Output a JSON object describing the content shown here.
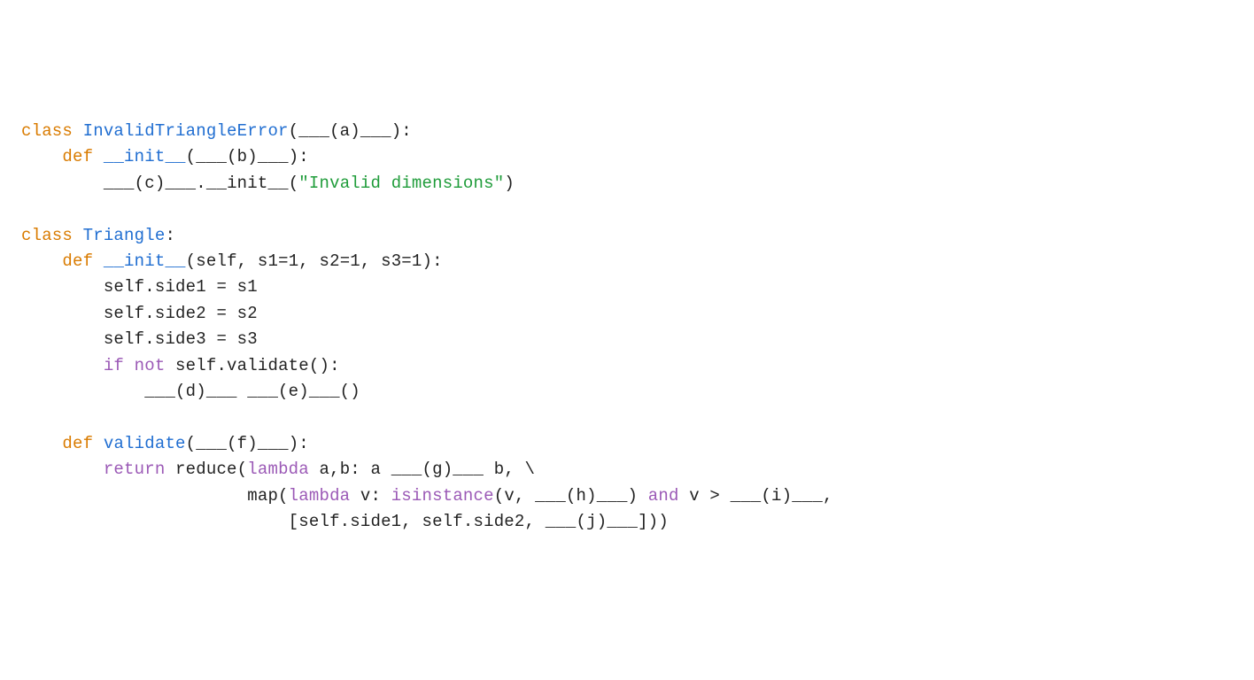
{
  "code": {
    "l1": {
      "kw_class": "class ",
      "name": "InvalidTriangleError",
      "tail": "(___(a)___):"
    },
    "l2": {
      "indent": "    ",
      "kw_def": "def ",
      "name": "__init__",
      "tail": "(___(b)___):"
    },
    "l3": {
      "indent": "        ",
      "pre": "___(c)___.",
      "call": "__init__",
      "paren_open": "(",
      "str": "\"Invalid dimensions\"",
      "paren_close": ")"
    },
    "l4": "",
    "l5": {
      "kw_class": "class ",
      "name": "Triangle",
      "tail": ":"
    },
    "l6": {
      "indent": "    ",
      "kw_def": "def ",
      "name": "__init__",
      "params": "(self, s1=1, s2=1, s3=1):"
    },
    "l7": {
      "indent": "        ",
      "text": "self.side1 = s1"
    },
    "l8": {
      "indent": "        ",
      "text": "self.side2 = s2"
    },
    "l9": {
      "indent": "        ",
      "text": "self.side3 = s3"
    },
    "l10": {
      "indent": "        ",
      "kw": "if not ",
      "expr": "self.validate():"
    },
    "l11": {
      "indent": "            ",
      "text": "___(d)___ ___(e)___()"
    },
    "l12": "",
    "l13": {
      "indent": "    ",
      "kw_def": "def ",
      "name": "validate",
      "params": "(___(f)___):"
    },
    "l14": {
      "indent": "        ",
      "kw_return": "return ",
      "reduce": "reduce(",
      "kw_lambda": "lambda ",
      "lam_body": "a,b: a ___(g)___ b, \\"
    },
    "l15": {
      "indent": "                      ",
      "map": "map(",
      "kw_lambda": "lambda ",
      "v": "v: ",
      "kw_isinstance": "isinstance",
      "after_isinstance": "(v, ___(h)___) ",
      "kw_and": "and ",
      "v_gt": "v > ___(i)___,"
    },
    "l16": {
      "indent": "                          ",
      "text": "[self.side1, self.side2, ___(j)___]))"
    }
  }
}
